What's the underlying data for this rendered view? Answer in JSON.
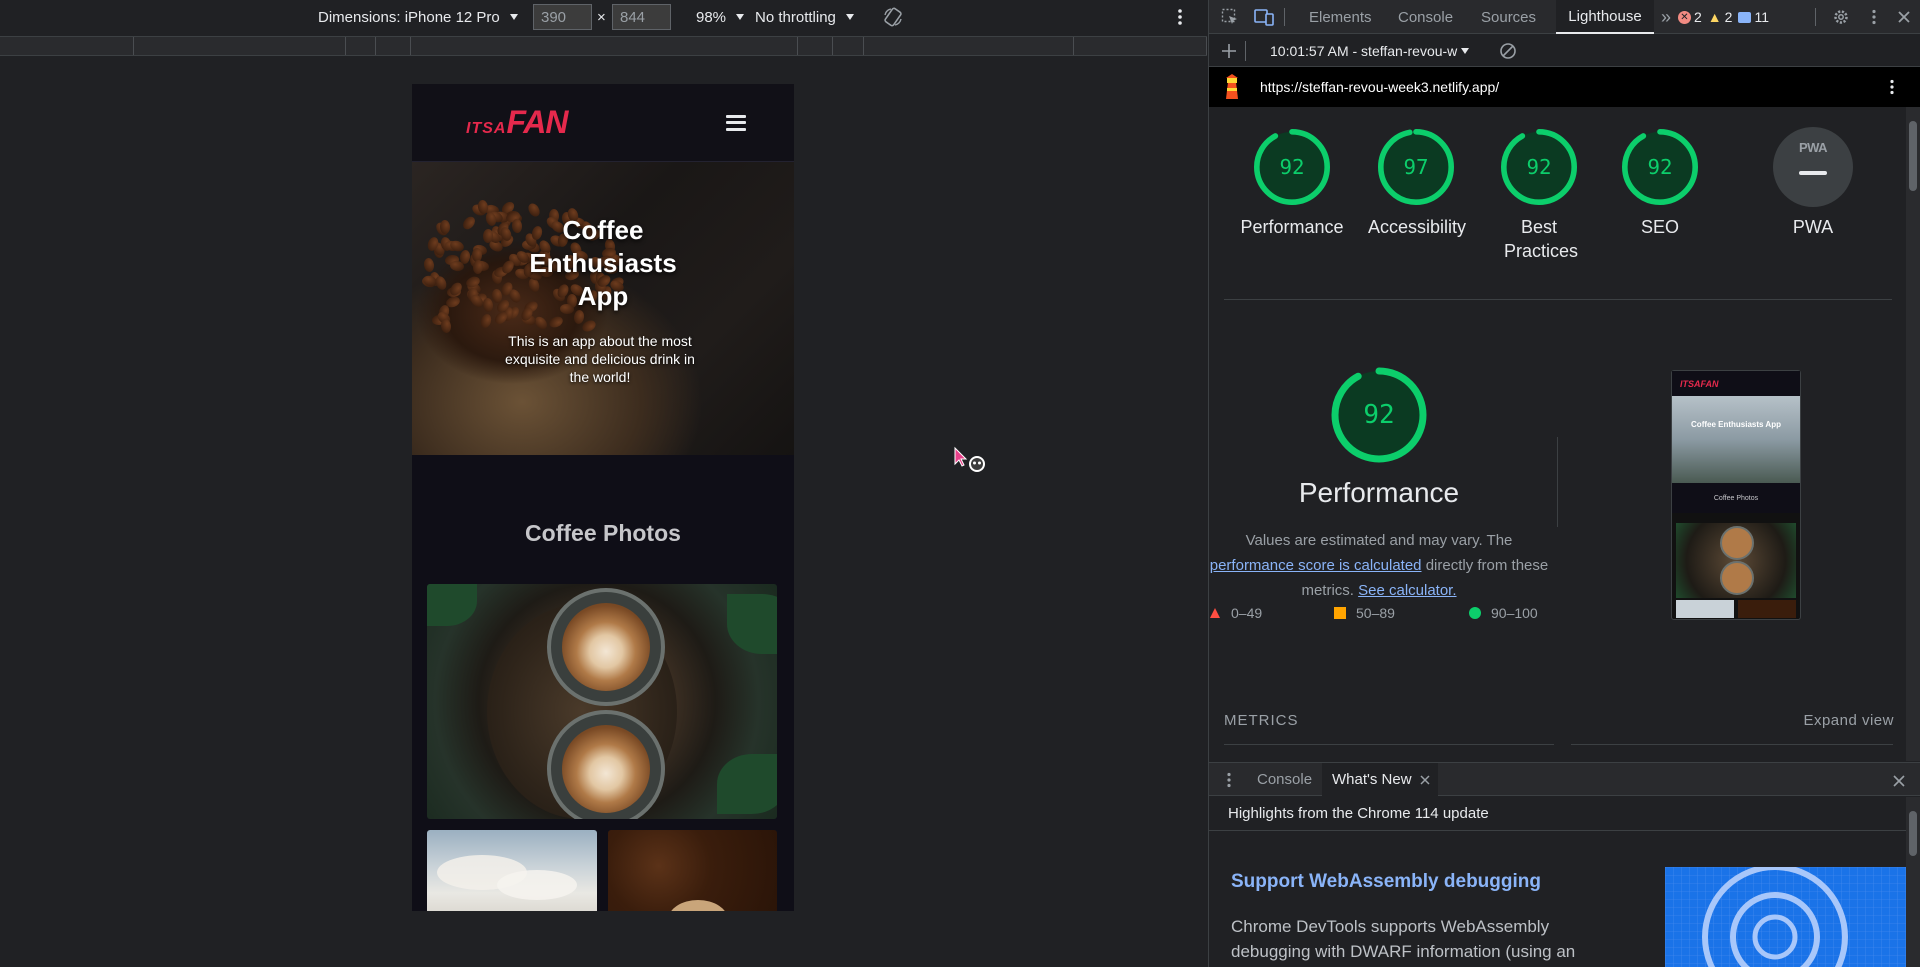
{
  "emulation": {
    "dimensions_label": "Dimensions: iPhone 12 Pro",
    "width_value": "390",
    "times": "×",
    "height_value": "844",
    "zoom": "98%",
    "throttling": "No throttling"
  },
  "site": {
    "logo_small": "ITSA",
    "logo_big": "FAN",
    "hero_title": "Coffee Enthusiasts App",
    "hero_subtitle": "This is an app about the most exquisite and delicious drink in the world!",
    "section_title": "Coffee Photos"
  },
  "devtools": {
    "tabs": [
      "Elements",
      "Console",
      "Sources",
      "Lighthouse"
    ],
    "active_tab": "Lighthouse",
    "errors_count": "2",
    "warnings_count": "2",
    "messages_count": "11",
    "report_selector": "10:01:57 AM - steffan-revou-w",
    "url": "https://steffan-revou-week3.netlify.app/"
  },
  "lighthouse": {
    "scores": [
      {
        "label": "Performance",
        "value": 92
      },
      {
        "label": "Accessibility",
        "value": 97
      },
      {
        "label": "Best Practices",
        "value": 92
      },
      {
        "label": "SEO",
        "value": 92
      }
    ],
    "pwa_label": "PWA",
    "pwa_badge": "PWA",
    "perf_score": 92,
    "perf_title": "Performance",
    "perf_desc_1": "Values are estimated and may vary. The",
    "perf_link_1": "performance score is calculated",
    "perf_desc_2": "directly from these metrics.",
    "perf_link_2": "See calculator.",
    "legend": [
      {
        "range": "0–49",
        "color": "#ff4e42"
      },
      {
        "range": "50–89",
        "color": "#ffa400"
      },
      {
        "range": "90–100",
        "color": "#0cce6b"
      }
    ],
    "thumb_logo": "ITSAFAN",
    "thumb_title": "Coffee Enthusiasts App",
    "thumb_section": "Coffee Photos",
    "metrics_label": "METRICS",
    "expand_label": "Expand view"
  },
  "drawer": {
    "tabs": [
      "Console",
      "What's New"
    ],
    "active_tab": "What's New",
    "highlights": "Highlights from the Chrome 114 update",
    "feature_title": "Support WebAssembly debugging",
    "feature_body": "Chrome DevTools supports WebAssembly debugging with DWARF information (using an"
  },
  "colors": {
    "pass": "#0cce6b",
    "pass_bg": "#0b3a22",
    "link": "#8ab4f8",
    "logo_red": "#e5294c"
  }
}
